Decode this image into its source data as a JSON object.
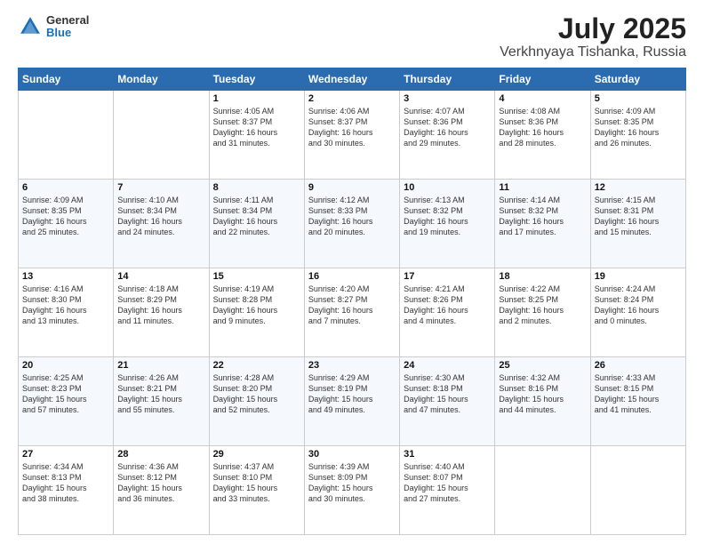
{
  "header": {
    "logo_general": "General",
    "logo_blue": "Blue",
    "title": "July 2025",
    "location": "Verkhnyaya Tishanka, Russia"
  },
  "days_of_week": [
    "Sunday",
    "Monday",
    "Tuesday",
    "Wednesday",
    "Thursday",
    "Friday",
    "Saturday"
  ],
  "weeks": [
    [
      {
        "num": "",
        "info": ""
      },
      {
        "num": "",
        "info": ""
      },
      {
        "num": "1",
        "info": "Sunrise: 4:05 AM\nSunset: 8:37 PM\nDaylight: 16 hours\nand 31 minutes."
      },
      {
        "num": "2",
        "info": "Sunrise: 4:06 AM\nSunset: 8:37 PM\nDaylight: 16 hours\nand 30 minutes."
      },
      {
        "num": "3",
        "info": "Sunrise: 4:07 AM\nSunset: 8:36 PM\nDaylight: 16 hours\nand 29 minutes."
      },
      {
        "num": "4",
        "info": "Sunrise: 4:08 AM\nSunset: 8:36 PM\nDaylight: 16 hours\nand 28 minutes."
      },
      {
        "num": "5",
        "info": "Sunrise: 4:09 AM\nSunset: 8:35 PM\nDaylight: 16 hours\nand 26 minutes."
      }
    ],
    [
      {
        "num": "6",
        "info": "Sunrise: 4:09 AM\nSunset: 8:35 PM\nDaylight: 16 hours\nand 25 minutes."
      },
      {
        "num": "7",
        "info": "Sunrise: 4:10 AM\nSunset: 8:34 PM\nDaylight: 16 hours\nand 24 minutes."
      },
      {
        "num": "8",
        "info": "Sunrise: 4:11 AM\nSunset: 8:34 PM\nDaylight: 16 hours\nand 22 minutes."
      },
      {
        "num": "9",
        "info": "Sunrise: 4:12 AM\nSunset: 8:33 PM\nDaylight: 16 hours\nand 20 minutes."
      },
      {
        "num": "10",
        "info": "Sunrise: 4:13 AM\nSunset: 8:32 PM\nDaylight: 16 hours\nand 19 minutes."
      },
      {
        "num": "11",
        "info": "Sunrise: 4:14 AM\nSunset: 8:32 PM\nDaylight: 16 hours\nand 17 minutes."
      },
      {
        "num": "12",
        "info": "Sunrise: 4:15 AM\nSunset: 8:31 PM\nDaylight: 16 hours\nand 15 minutes."
      }
    ],
    [
      {
        "num": "13",
        "info": "Sunrise: 4:16 AM\nSunset: 8:30 PM\nDaylight: 16 hours\nand 13 minutes."
      },
      {
        "num": "14",
        "info": "Sunrise: 4:18 AM\nSunset: 8:29 PM\nDaylight: 16 hours\nand 11 minutes."
      },
      {
        "num": "15",
        "info": "Sunrise: 4:19 AM\nSunset: 8:28 PM\nDaylight: 16 hours\nand 9 minutes."
      },
      {
        "num": "16",
        "info": "Sunrise: 4:20 AM\nSunset: 8:27 PM\nDaylight: 16 hours\nand 7 minutes."
      },
      {
        "num": "17",
        "info": "Sunrise: 4:21 AM\nSunset: 8:26 PM\nDaylight: 16 hours\nand 4 minutes."
      },
      {
        "num": "18",
        "info": "Sunrise: 4:22 AM\nSunset: 8:25 PM\nDaylight: 16 hours\nand 2 minutes."
      },
      {
        "num": "19",
        "info": "Sunrise: 4:24 AM\nSunset: 8:24 PM\nDaylight: 16 hours\nand 0 minutes."
      }
    ],
    [
      {
        "num": "20",
        "info": "Sunrise: 4:25 AM\nSunset: 8:23 PM\nDaylight: 15 hours\nand 57 minutes."
      },
      {
        "num": "21",
        "info": "Sunrise: 4:26 AM\nSunset: 8:21 PM\nDaylight: 15 hours\nand 55 minutes."
      },
      {
        "num": "22",
        "info": "Sunrise: 4:28 AM\nSunset: 8:20 PM\nDaylight: 15 hours\nand 52 minutes."
      },
      {
        "num": "23",
        "info": "Sunrise: 4:29 AM\nSunset: 8:19 PM\nDaylight: 15 hours\nand 49 minutes."
      },
      {
        "num": "24",
        "info": "Sunrise: 4:30 AM\nSunset: 8:18 PM\nDaylight: 15 hours\nand 47 minutes."
      },
      {
        "num": "25",
        "info": "Sunrise: 4:32 AM\nSunset: 8:16 PM\nDaylight: 15 hours\nand 44 minutes."
      },
      {
        "num": "26",
        "info": "Sunrise: 4:33 AM\nSunset: 8:15 PM\nDaylight: 15 hours\nand 41 minutes."
      }
    ],
    [
      {
        "num": "27",
        "info": "Sunrise: 4:34 AM\nSunset: 8:13 PM\nDaylight: 15 hours\nand 38 minutes."
      },
      {
        "num": "28",
        "info": "Sunrise: 4:36 AM\nSunset: 8:12 PM\nDaylight: 15 hours\nand 36 minutes."
      },
      {
        "num": "29",
        "info": "Sunrise: 4:37 AM\nSunset: 8:10 PM\nDaylight: 15 hours\nand 33 minutes."
      },
      {
        "num": "30",
        "info": "Sunrise: 4:39 AM\nSunset: 8:09 PM\nDaylight: 15 hours\nand 30 minutes."
      },
      {
        "num": "31",
        "info": "Sunrise: 4:40 AM\nSunset: 8:07 PM\nDaylight: 15 hours\nand 27 minutes."
      },
      {
        "num": "",
        "info": ""
      },
      {
        "num": "",
        "info": ""
      }
    ]
  ]
}
